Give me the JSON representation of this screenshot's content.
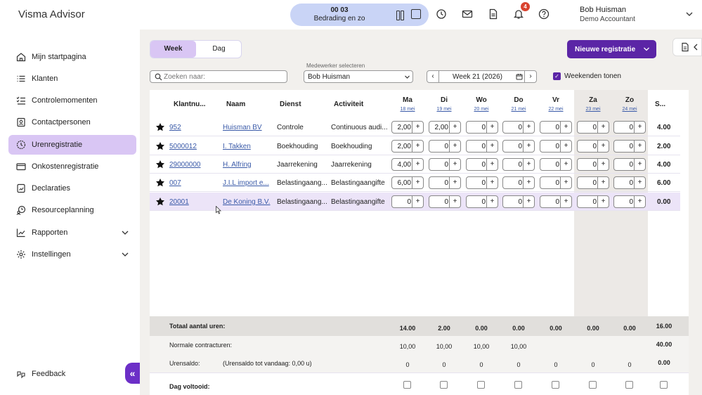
{
  "app": {
    "title": "Visma Advisor"
  },
  "timer": {
    "time": "00 03",
    "activity": "Bedrading en zo"
  },
  "notifications": {
    "count": "4"
  },
  "user": {
    "name": "Bob Huisman",
    "role": "Demo Accountant"
  },
  "sidebar": {
    "items": [
      {
        "label": "Mijn startpagina",
        "icon": "home-icon"
      },
      {
        "label": "Klanten",
        "icon": "list-icon"
      },
      {
        "label": "Controlemomenten",
        "icon": "checklist-icon"
      },
      {
        "label": "Contactpersonen",
        "icon": "contact-card-icon"
      },
      {
        "label": "Urenregistratie",
        "icon": "clock-icon",
        "active": true
      },
      {
        "label": "Onkostenregistratie",
        "icon": "credit-card-icon"
      },
      {
        "label": "Declaraties",
        "icon": "receipt-icon"
      },
      {
        "label": "Resourceplanning",
        "icon": "clock-people-icon"
      },
      {
        "label": "Rapporten",
        "icon": "chart-icon",
        "expandable": true
      },
      {
        "label": "Instellingen",
        "icon": "gear-icon",
        "expandable": true
      }
    ],
    "feedback": "Feedback",
    "collapse": "«"
  },
  "toolbar": {
    "view_week": "Week",
    "view_day": "Dag",
    "new_button": "Nieuwe registratie",
    "search_placeholder": "Zoeken naar:",
    "employee_label": "Medewerker selecteren",
    "employee_value": "Bob Huisman",
    "week_label": "Week 21 (2026)",
    "weekend_label": "Weekenden tonen"
  },
  "table": {
    "headers": {
      "client": "Klantnu...",
      "name": "Naam",
      "service": "Dienst",
      "activity": "Activiteit",
      "sum": "S..."
    },
    "days": [
      {
        "name": "Ma",
        "date": "18 mei"
      },
      {
        "name": "Di",
        "date": "19 mei"
      },
      {
        "name": "Wo",
        "date": "20 mei"
      },
      {
        "name": "Do",
        "date": "21 mei"
      },
      {
        "name": "Vr",
        "date": "22 mei"
      },
      {
        "name": "Za",
        "date": "23 mei"
      },
      {
        "name": "Zo",
        "date": "24 mei"
      }
    ],
    "plus": "+",
    "rows": [
      {
        "client": "952",
        "name": "Huisman BV",
        "service": "Controle",
        "activity": "Continuous audi...",
        "hours": [
          "2,00",
          "2,00",
          "0",
          "0",
          "0",
          "0",
          "0"
        ],
        "total": "4.00"
      },
      {
        "client": "5000012",
        "name": "I. Takken",
        "service": "Boekhouding",
        "activity": "Boekhouding",
        "hours": [
          "2,00",
          "0",
          "0",
          "0",
          "0",
          "0",
          "0"
        ],
        "total": "2.00"
      },
      {
        "client": "29000000",
        "name": "H. Alfring",
        "service": "Jaarrekening",
        "activity": "Jaarrekening",
        "hours": [
          "4,00",
          "0",
          "0",
          "0",
          "0",
          "0",
          "0"
        ],
        "total": "4.00"
      },
      {
        "client": "007",
        "name": "J.I.L import e...",
        "service": "Belastingaang...",
        "activity": "Belastingaangifte",
        "hours": [
          "6,00",
          "0",
          "0",
          "0",
          "0",
          "0",
          "0"
        ],
        "total": "6.00"
      },
      {
        "client": "20001",
        "name": "De Koning B.V.",
        "service": "Belastingaang...",
        "activity": "Belastingaangifte",
        "hours": [
          "0",
          "0",
          "0",
          "0",
          "0",
          "0",
          "0"
        ],
        "total": "0.00"
      }
    ]
  },
  "footer": {
    "total_label": "Totaal aantal uren:",
    "totals": [
      "14.00",
      "2.00",
      "0.00",
      "0.00",
      "0.00",
      "0.00",
      "0.00"
    ],
    "grand_total": "16.00",
    "contract_label": "Normale contracturen:",
    "contract": [
      "10,00",
      "10,00",
      "10,00",
      "10,00",
      "",
      "",
      ""
    ],
    "contract_total": "40.00",
    "saldo_label": "Urensaldo:",
    "saldo_note": "(Urensaldo tot vandaag: 0,00 u)",
    "saldo": [
      "0",
      "0",
      "0",
      "0",
      "0",
      "0",
      "0"
    ],
    "saldo_total": "0.00",
    "done_label": "Dag voltooid:"
  }
}
